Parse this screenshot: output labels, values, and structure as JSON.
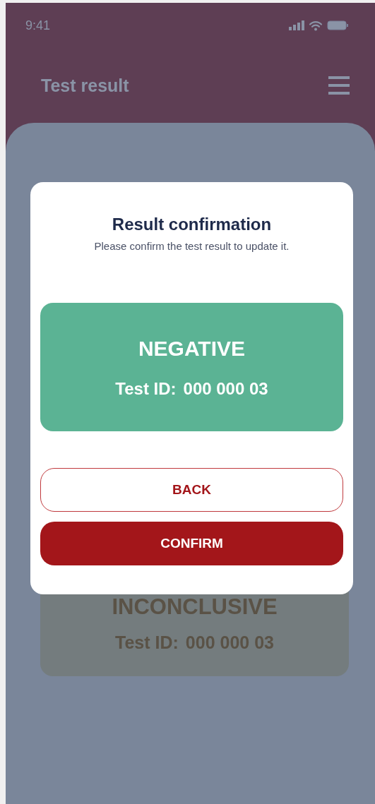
{
  "status_bar": {
    "time": "9:41"
  },
  "header": {
    "title": "Test result"
  },
  "background_card": {
    "result": "INCONCLUSIVE",
    "id_label": "Test ID:",
    "id_value": "000 000 03"
  },
  "dialog": {
    "title": "Result confirmation",
    "message": "Please confirm the test result to update it.",
    "result_card": {
      "result": "NEGATIVE",
      "id_label": "Test ID:",
      "id_value": "000 000 03"
    },
    "buttons": [
      {
        "label": "BACK",
        "kind": "outline"
      },
      {
        "label": "CONFIRM",
        "kind": "filled"
      }
    ]
  }
}
